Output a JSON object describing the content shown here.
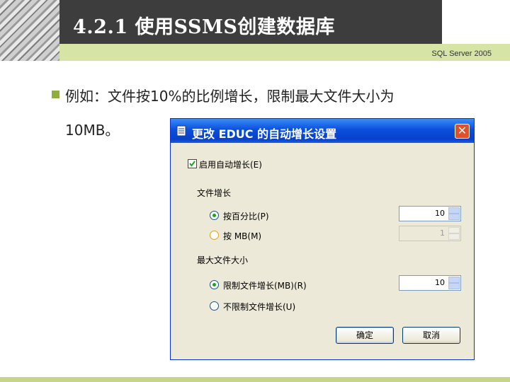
{
  "header": {
    "title": "4.2.1  使用SSMS创建数据库",
    "subtitle": "SQL Server 2005"
  },
  "body": {
    "line1": "例如：文件按10%的比例增长，限制最大文件大小为",
    "line2": "10MB。"
  },
  "dialog": {
    "title": "更改 EDUC 的自动增长设置",
    "enable_autogrowth": {
      "label": "启用自动增长(E)",
      "checked": true
    },
    "file_growth_label": "文件增长",
    "growth_options": [
      {
        "label": "按百分比(P)",
        "selected": true,
        "value": "10"
      },
      {
        "label": "按 MB(M)",
        "selected": false,
        "value": "1"
      }
    ],
    "max_size_label": "最大文件大小",
    "max_options": [
      {
        "label": "限制文件增长(MB)(R)",
        "selected": true,
        "value": "10"
      },
      {
        "label": "不限制文件增长(U)",
        "selected": false
      }
    ],
    "ok_label": "确定",
    "cancel_label": "取消"
  },
  "colors": {
    "title_bar": "#0a4fdc",
    "accent_band": "#d6e4a6",
    "bullet": "#8fae3a"
  }
}
